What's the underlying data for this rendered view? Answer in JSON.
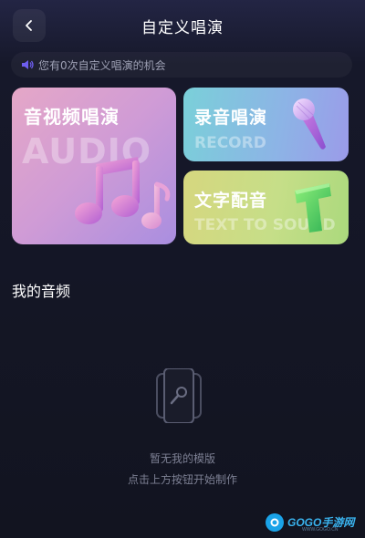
{
  "header": {
    "title": "自定义唱演"
  },
  "notice": {
    "text": "您有0次自定义唱演的机会",
    "icon": "speaker-icon"
  },
  "cards": {
    "audio": {
      "title": "音视频唱演",
      "watermark": "AUDIO",
      "icon": "music-note-icon"
    },
    "record": {
      "title": "录音唱演",
      "watermark": "RECORD",
      "icon": "microphone-icon"
    },
    "text": {
      "title": "文字配音",
      "watermark": "TEXT TO SOUND",
      "icon": "letter-t-icon"
    }
  },
  "my_audio": {
    "title": "我的音频",
    "empty_title": "暂无我的模版",
    "empty_hint": "点击上方按钮开始制作",
    "empty_icon": "empty-template-icon"
  },
  "watermark": {
    "brand": "GOGO手游网",
    "url": "WWW.GOGO.CN"
  },
  "colors": {
    "accent": "#6d5ef0",
    "background": "#121420"
  }
}
